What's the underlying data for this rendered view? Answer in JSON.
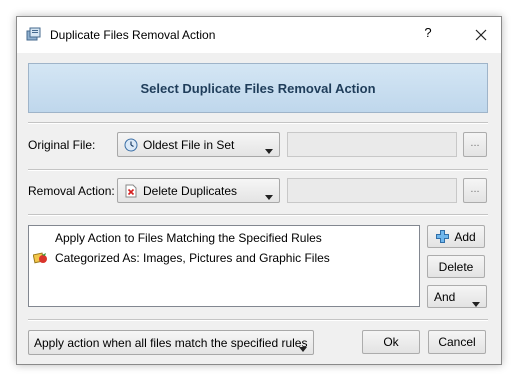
{
  "window": {
    "title": "Duplicate Files Removal Action",
    "help_label": "?"
  },
  "banner": {
    "text": "Select Duplicate Files Removal Action"
  },
  "original_file": {
    "label": "Original File:",
    "selected": "Oldest File in Set",
    "icon": "clock-icon",
    "browse_label": "..."
  },
  "removal_action": {
    "label": "Removal Action:",
    "selected": "Delete Duplicates",
    "icon": "delete-icon",
    "browse_label": "..."
  },
  "rules": {
    "header": "Apply Action to Files Matching the Specified Rules",
    "items": [
      {
        "icon": "image-files-icon",
        "text": "Categorized As: Images, Pictures and Graphic Files"
      }
    ]
  },
  "side_buttons": {
    "add_label": "Add",
    "delete_label": "Delete",
    "logic_selected": "And"
  },
  "bottom": {
    "match_mode": "Apply action when all files match the specified rules",
    "ok_label": "Ok",
    "cancel_label": "Cancel"
  },
  "colors": {
    "banner_bg": "#c8def0",
    "banner_text": "#1f3d5a",
    "dialog_bg": "#f0f0f0"
  }
}
